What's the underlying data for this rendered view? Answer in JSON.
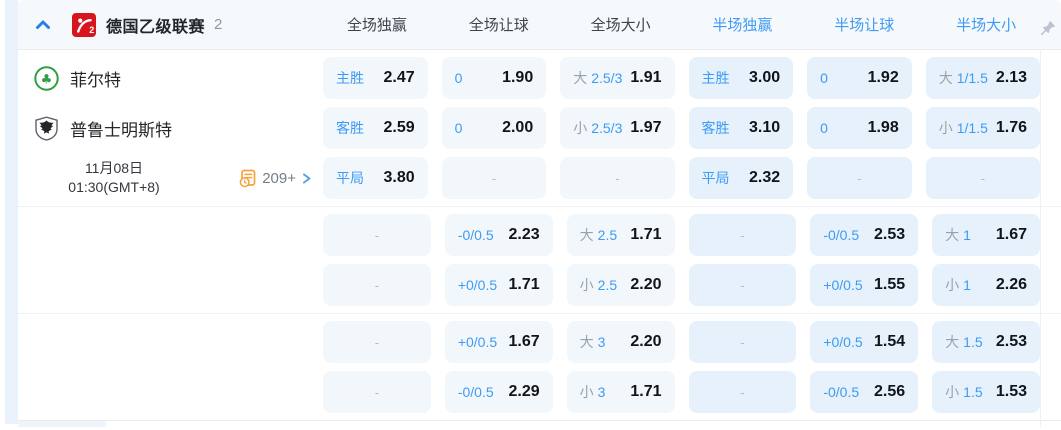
{
  "colors": {
    "accent_blue": "#3e9bf4",
    "chevron_blue": "#2a7de3",
    "odds_text": "#111418",
    "muted_gray": "#99a1ab",
    "full_cell_bg": "#f2f7fc",
    "half_cell_bg": "#e6f1fc",
    "league_logo_red": "#d6151d",
    "clover_green": "#2f9e44",
    "markets_icon_orange": "#f5a33b",
    "pin_gray": "#bcc3ce"
  },
  "header": {
    "collapse_icon": "chevron-up-icon",
    "league": "德国乙级联赛",
    "match_count": "2",
    "pin_icon": "pin-icon",
    "columns": [
      {
        "label": "全场独赢",
        "half": false
      },
      {
        "label": "全场让球",
        "half": false
      },
      {
        "label": "全场大小",
        "half": false
      },
      {
        "label": "半场独赢",
        "half": true
      },
      {
        "label": "半场让球",
        "half": true
      },
      {
        "label": "半场大小",
        "half": true
      }
    ]
  },
  "match": {
    "home": {
      "name": "菲尔特",
      "logo": "clover-badge"
    },
    "away": {
      "name": "普鲁士明斯特",
      "logo": "eagle-crest"
    },
    "kickoff_date": "11月08日",
    "kickoff_time": "01:30(GMT+8)",
    "more_markets_count": "209+",
    "more_markets_icon": "markets-clock-icon",
    "more_markets_arrow": "chevron-right-icon"
  },
  "odds": {
    "groups": [
      {
        "rows": [
          [
            {
              "side": "主胜",
              "odds": "2.47"
            },
            {
              "hd": "0",
              "odds": "1.90"
            },
            {
              "ou": "大",
              "line": "2.5/3",
              "odds": "1.91"
            },
            {
              "side": "主胜",
              "odds": "3.00"
            },
            {
              "hd": "0",
              "odds": "1.92"
            },
            {
              "ou": "大",
              "line": "1/1.5",
              "odds": "2.13"
            }
          ],
          [
            {
              "side": "客胜",
              "odds": "2.59"
            },
            {
              "hd": "0",
              "odds": "2.00"
            },
            {
              "ou": "小",
              "line": "2.5/3",
              "odds": "1.97"
            },
            {
              "side": "客胜",
              "odds": "3.10"
            },
            {
              "hd": "0",
              "odds": "1.98"
            },
            {
              "ou": "小",
              "line": "1/1.5",
              "odds": "1.76"
            }
          ],
          [
            {
              "side": "平局",
              "odds": "3.80"
            },
            {
              "dash": true
            },
            {
              "dash": true
            },
            {
              "side": "平局",
              "odds": "2.32"
            },
            {
              "dash": true
            },
            {
              "dash": true
            }
          ]
        ]
      },
      {
        "rows": [
          [
            {
              "dash": true
            },
            {
              "hd": "-0/0.5",
              "odds": "2.23"
            },
            {
              "ou": "大",
              "line": "2.5",
              "odds": "1.71"
            },
            {
              "dash": true
            },
            {
              "hd": "-0/0.5",
              "odds": "2.53"
            },
            {
              "ou": "大",
              "line": "1",
              "odds": "1.67"
            }
          ],
          [
            {
              "dash": true
            },
            {
              "hd": "+0/0.5",
              "odds": "1.71"
            },
            {
              "ou": "小",
              "line": "2.5",
              "odds": "2.20"
            },
            {
              "dash": true
            },
            {
              "hd": "+0/0.5",
              "odds": "1.55"
            },
            {
              "ou": "小",
              "line": "1",
              "odds": "2.26"
            }
          ]
        ]
      },
      {
        "rows": [
          [
            {
              "dash": true
            },
            {
              "hd": "+0/0.5",
              "odds": "1.67"
            },
            {
              "ou": "大",
              "line": "3",
              "odds": "2.20"
            },
            {
              "dash": true
            },
            {
              "hd": "+0/0.5",
              "odds": "1.54"
            },
            {
              "ou": "大",
              "line": "1.5",
              "odds": "2.53"
            }
          ],
          [
            {
              "dash": true
            },
            {
              "hd": "-0/0.5",
              "odds": "2.29"
            },
            {
              "ou": "小",
              "line": "3",
              "odds": "1.71"
            },
            {
              "dash": true
            },
            {
              "hd": "-0/0.5",
              "odds": "2.56"
            },
            {
              "ou": "小",
              "line": "1.5",
              "odds": "1.53"
            }
          ]
        ]
      }
    ]
  }
}
